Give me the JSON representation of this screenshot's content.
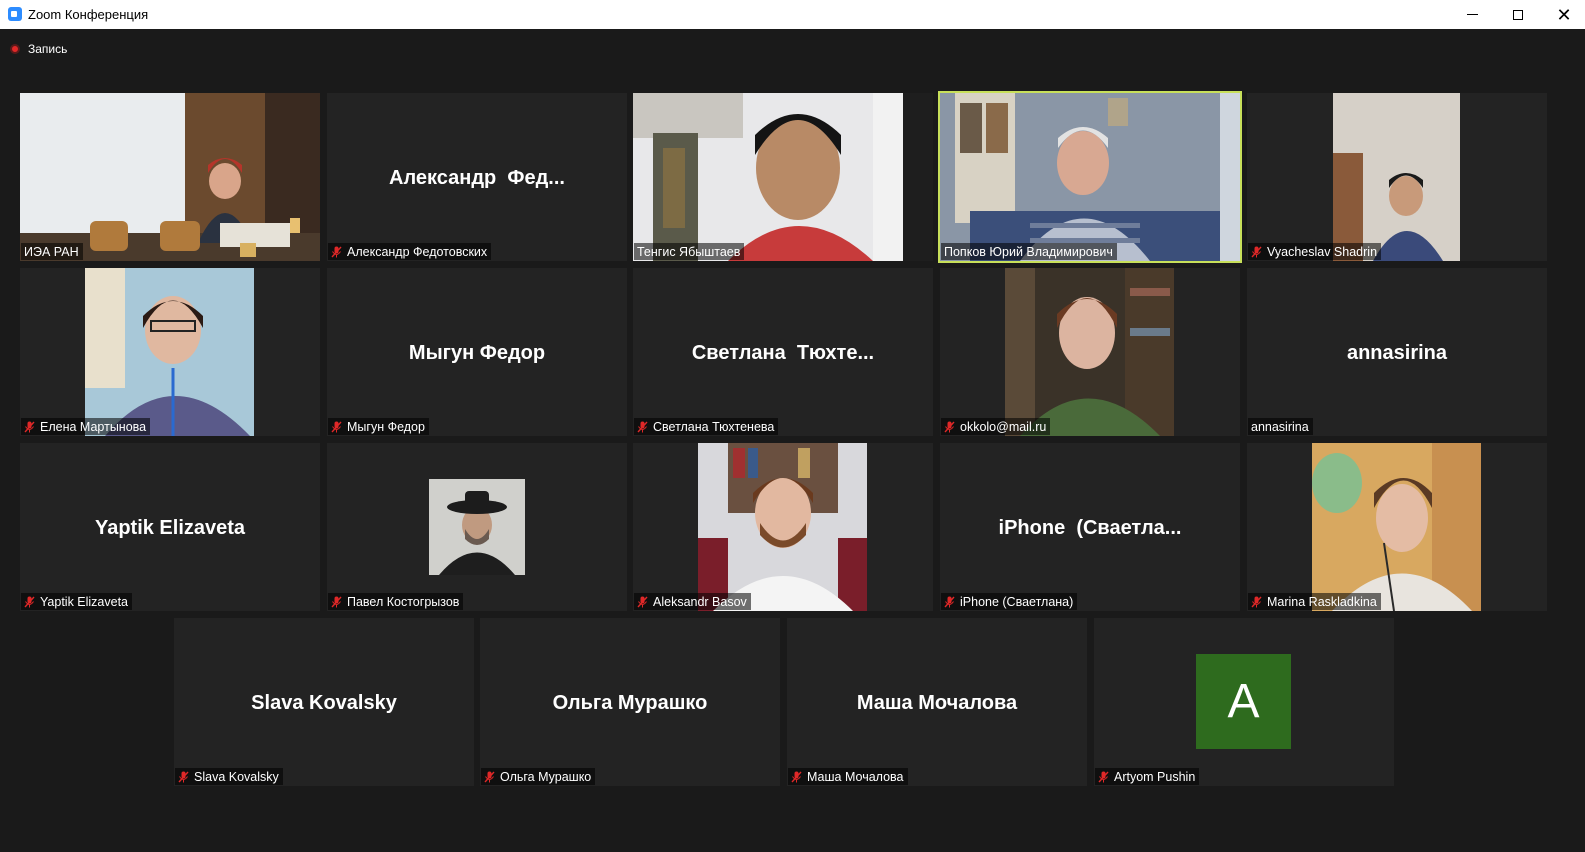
{
  "window": {
    "title": "Zoom Конференция",
    "minimize_icon": "minimize-icon",
    "maximize_icon": "maximize-icon",
    "close_icon": "close-icon"
  },
  "recording": {
    "label": "Запись",
    "color": "#e02828"
  },
  "colors": {
    "background": "#1a1a1a",
    "tile": "#232323",
    "active_speaker": "#c8e05a",
    "mute": "#e02828",
    "avatar": "#2e6b1e"
  },
  "participants": [
    {
      "name": "ИЭА РАН",
      "display": "",
      "muted": false,
      "video": true
    },
    {
      "name": "Александр Федотовских",
      "display": "Александр  Фед...",
      "muted": true,
      "video": false
    },
    {
      "name": "Тенгис Ябыштаев",
      "display": "",
      "muted": false,
      "video": true
    },
    {
      "name": "Попков Юрий Владимирович",
      "display": "",
      "muted": false,
      "video": true,
      "active": true
    },
    {
      "name": "Vyacheslav Shadrin",
      "display": "",
      "muted": true,
      "video": true
    },
    {
      "name": "Елена Мартынова",
      "display": "",
      "muted": true,
      "video": true
    },
    {
      "name": "Мыгун Федор",
      "display": "Мыгун Федор",
      "muted": true,
      "video": false
    },
    {
      "name": "Светлана Тюхтенева",
      "display": "Светлана  Тюхте...",
      "muted": true,
      "video": false
    },
    {
      "name": "okkolo@mail.ru",
      "display": "",
      "muted": true,
      "video": true
    },
    {
      "name": "annasirina",
      "display": "annasirina",
      "muted": false,
      "video": false
    },
    {
      "name": "Yaptik Elizaveta",
      "display": "Yaptik Elizaveta",
      "muted": true,
      "video": false
    },
    {
      "name": "Павел Костогрызов",
      "display": "",
      "muted": true,
      "video": false
    },
    {
      "name": "Aleksandr Basov",
      "display": "",
      "muted": true,
      "video": true
    },
    {
      "name": "iPhone (Сваетлана)",
      "display": "iPhone  (Сваетла...",
      "muted": true,
      "video": false
    },
    {
      "name": "Marina Raskladkina",
      "display": "",
      "muted": true,
      "video": true
    },
    {
      "name": "Slava Kovalsky",
      "display": "Slava Kovalsky",
      "muted": true,
      "video": false
    },
    {
      "name": "Ольга Мурашко",
      "display": "Ольга Мурашко",
      "muted": true,
      "video": false
    },
    {
      "name": "Маша Мочалова",
      "display": "Маша Мочалова",
      "muted": true,
      "video": false
    },
    {
      "name": "Artyom Pushin",
      "display": "",
      "muted": true,
      "video": false,
      "avatar_letter": "A"
    }
  ]
}
